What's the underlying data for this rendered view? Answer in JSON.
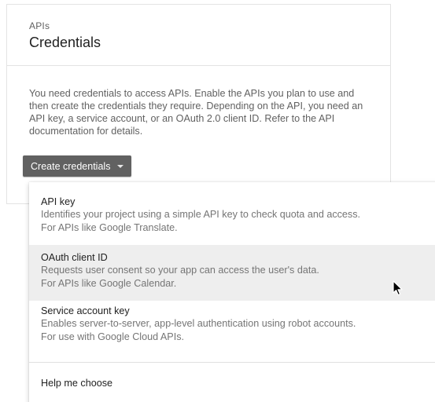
{
  "card": {
    "eyebrow": "APIs",
    "title": "Credentials",
    "description": "You need credentials to access APIs. Enable the APIs you plan to use and then create the credentials they require. Depending on the API, you need an API key, a service account, or an OAuth 2.0 client ID. Refer to the API documentation for details."
  },
  "button": {
    "label": "Create credentials",
    "icon": "caret-down-icon"
  },
  "menu": {
    "items": [
      {
        "title": "API key",
        "desc_line1": "Identifies your project using a simple API key to check quota and access.",
        "desc_line2": "For APIs like Google Translate."
      },
      {
        "title": "OAuth client ID",
        "desc_line1": "Requests user consent so your app can access the user's data.",
        "desc_line2": "For APIs like Google Calendar."
      },
      {
        "title": "Service account key",
        "desc_line1": "Enables server-to-server, app-level authentication using robot accounts.",
        "desc_line2": "For use with Google Cloud APIs."
      },
      {
        "title": "Help me choose"
      }
    ]
  },
  "colors": {
    "button_bg": "#616161",
    "hover_bg": "#eeeeee",
    "primary_text": "#212121",
    "secondary_text": "#757575"
  }
}
